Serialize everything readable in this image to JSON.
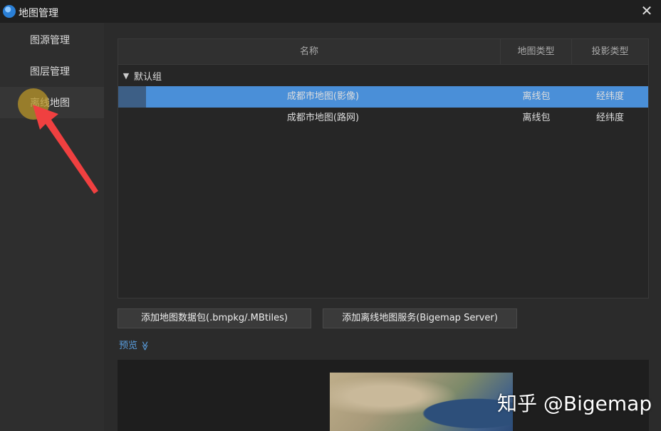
{
  "window": {
    "title": "地图管理",
    "close_icon": "✕"
  },
  "sidebar": {
    "items": [
      {
        "label": "图源管理"
      },
      {
        "label": "图层管理"
      },
      {
        "label": "离线地图"
      }
    ],
    "active_index": 2
  },
  "table": {
    "columns": [
      "名称",
      "地图类型",
      "投影类型"
    ],
    "group": {
      "label": "默认组",
      "expanded": true
    },
    "rows": [
      {
        "name": "成都市地图(影像)",
        "map_type": "离线包",
        "projection": "经纬度",
        "selected": true
      },
      {
        "name": "成都市地图(路网)",
        "map_type": "离线包",
        "projection": "经纬度",
        "selected": false
      }
    ]
  },
  "buttons": {
    "add_package": "添加地图数据包(.bmpkg/.MBtiles)",
    "add_service": "添加离线地图服务(Bigemap Server)"
  },
  "preview": {
    "label": "预览",
    "toggle_icon": "≫"
  },
  "watermark": "知乎 @Bigemap",
  "colors": {
    "selected_row": "#4a8fd8",
    "link": "#5a9fe0",
    "highlight": "#b99628",
    "arrow": "#f04040"
  }
}
